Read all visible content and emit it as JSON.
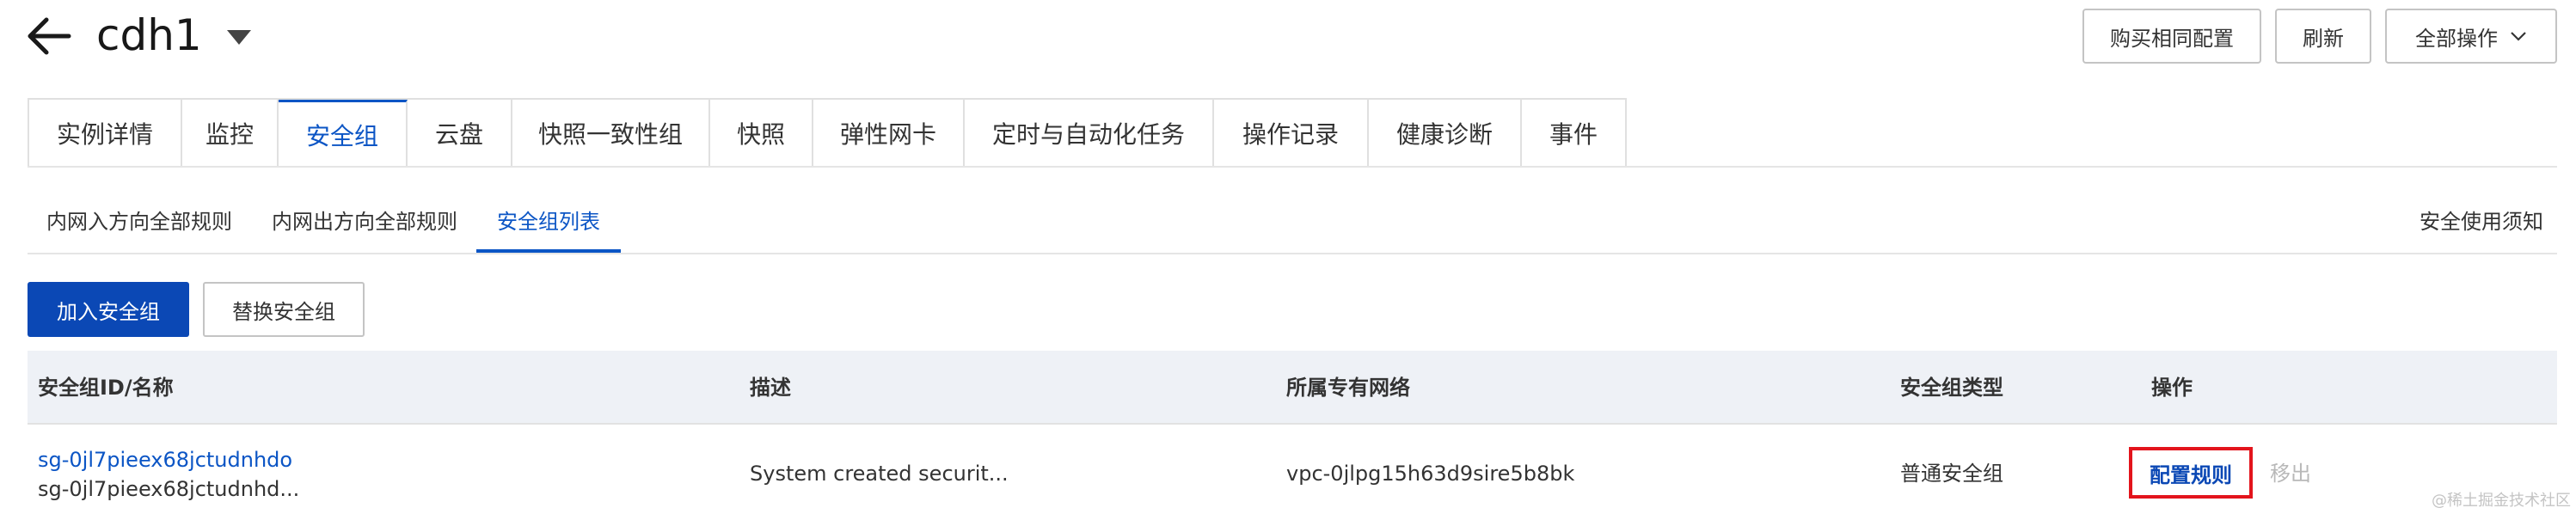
{
  "header": {
    "title": "cdh1",
    "buttons": {
      "buy_similar": "购买相同配置",
      "refresh": "刷新",
      "all_actions": "全部操作"
    }
  },
  "main_tabs": [
    {
      "label": "实例详情"
    },
    {
      "label": "监控"
    },
    {
      "label": "安全组",
      "active": true
    },
    {
      "label": "云盘"
    },
    {
      "label": "快照一致性组"
    },
    {
      "label": "快照"
    },
    {
      "label": "弹性网卡"
    },
    {
      "label": "定时与自动化任务"
    },
    {
      "label": "操作记录"
    },
    {
      "label": "健康诊断"
    },
    {
      "label": "事件"
    }
  ],
  "sub_tabs": [
    {
      "label": "内网入方向全部规则"
    },
    {
      "label": "内网出方向全部规则"
    },
    {
      "label": "安全组列表",
      "active": true
    }
  ],
  "security_notice": "安全使用须知",
  "actions": {
    "join": "加入安全组",
    "replace": "替换安全组"
  },
  "table": {
    "columns": [
      "安全组ID/名称",
      "描述",
      "所属专有网络",
      "安全组类型",
      "操作"
    ],
    "rows": [
      {
        "id": "sg-0jl7pieex68jctudnhdo",
        "name": "sg-0jl7pieex68jctudnhd...",
        "description": "System created securit...",
        "vpc": "vpc-0jlpg15h63d9sire5b8bk",
        "type": "普通安全组",
        "action_config": "配置规则",
        "action_remove": "移出"
      }
    ]
  },
  "watermark": "@稀土掘金技术社区",
  "colors": {
    "accent": "#0b55c5",
    "primary_button": "#0b48b5",
    "highlight_box": "#e3141c",
    "table_header_bg": "#eef1f6"
  },
  "icons": [
    "back-arrow-icon",
    "chevron-down-icon"
  ]
}
